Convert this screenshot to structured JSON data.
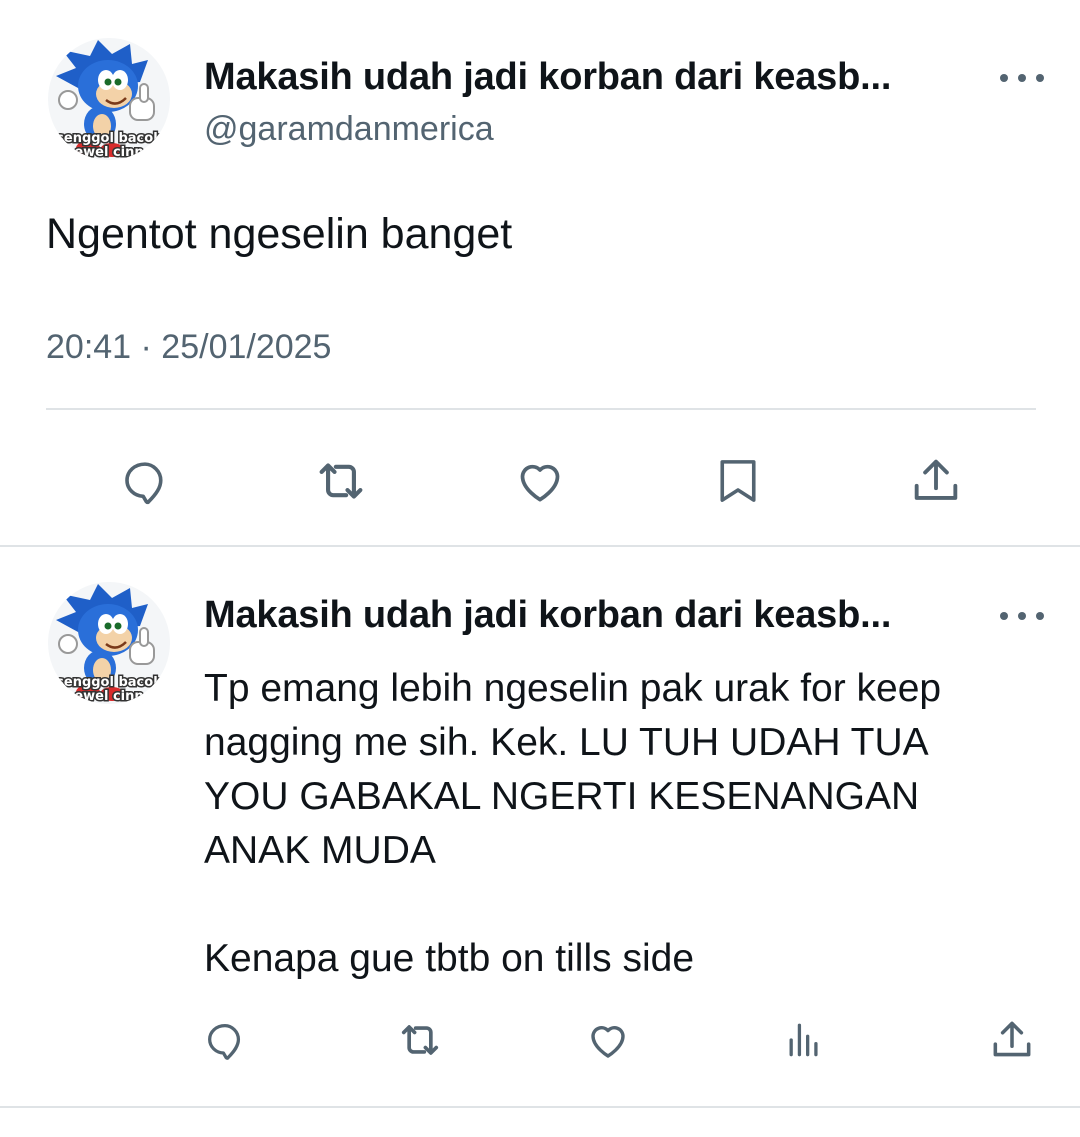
{
  "colors": {
    "text_primary": "#0f1419",
    "text_secondary": "#536471",
    "icon": "#536471",
    "divider": "#dfe3e6",
    "background": "#ffffff"
  },
  "main_tweet": {
    "author_name": "Makasih udah jadi korban dari keasb...",
    "author_handle": "@garamdanmerica",
    "avatar_icon": "sonic-thumbs-up-avatar",
    "avatar_caption_top": "senggol bacok",
    "avatar_caption_bottom": "ewel cinn",
    "more_icon": "more-options-icon",
    "text": "Ngentot ngeselin banget",
    "timestamp": "20:41 · 25/01/2025",
    "actions": [
      {
        "name": "reply",
        "icon": "reply-icon"
      },
      {
        "name": "retweet",
        "icon": "retweet-icon"
      },
      {
        "name": "like",
        "icon": "heart-icon"
      },
      {
        "name": "bookmark",
        "icon": "bookmark-icon"
      },
      {
        "name": "share",
        "icon": "share-icon"
      }
    ]
  },
  "reply_tweet": {
    "author_name": "Makasih udah jadi korban dari keasb...",
    "avatar_icon": "sonic-thumbs-up-avatar",
    "avatar_caption_top": "senggol bacok",
    "avatar_caption_bottom": "ewel cinn",
    "more_icon": "more-options-icon",
    "text": "Tp emang lebih ngeselin pak urak for keep\nnagging me sih. Kek. LU TUH UDAH TUA\nYOU GABAKAL NGERTI KESENANGAN\nANAK MUDA\n\nKenapa gue tbtb on tills side",
    "actions": [
      {
        "name": "reply",
        "icon": "reply-icon"
      },
      {
        "name": "retweet",
        "icon": "retweet-icon"
      },
      {
        "name": "like",
        "icon": "heart-icon"
      },
      {
        "name": "views",
        "icon": "views-icon"
      },
      {
        "name": "share",
        "icon": "share-icon"
      }
    ]
  }
}
